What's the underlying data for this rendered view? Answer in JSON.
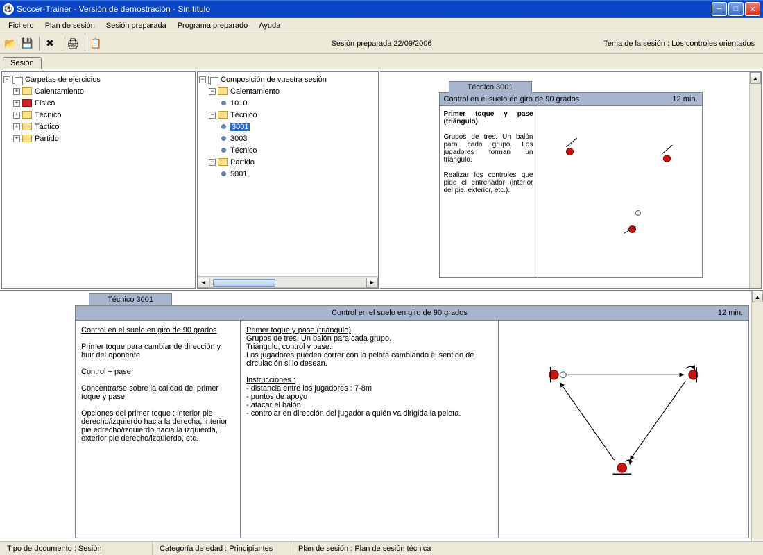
{
  "titlebar": "Soccer-Trainer - Versión de demostración - Sin título",
  "menu": {
    "fichero": "Fichero",
    "plan": "Plan de sesión",
    "sesion": "Sesión preparada",
    "programa": "Programa preparado",
    "ayuda": "Ayuda"
  },
  "info_center": "Sesión preparada 22/09/2006",
  "info_right": "Tema de la sesión : Los controles orientados",
  "tab": "Sesión",
  "tree_left": {
    "root": "Carpetas de ejercicios",
    "items": [
      "Calentamiento",
      "Físico",
      "Técnico",
      "Táctico",
      "Partido"
    ]
  },
  "tree_mid": {
    "root": "Composición de vuestra sesión",
    "cal_label": "Calentamiento",
    "cal_item": "1010",
    "tec_label": "Técnico",
    "tec_items": [
      "3001",
      "3003",
      "Técnico"
    ],
    "par_label": "Partido",
    "par_item": "5001"
  },
  "card_small": {
    "tab": "Técnico 3001",
    "title": "Control en el suelo en giro de 90 grados",
    "time": "12 min.",
    "heading": "Primer toque y pase (triángulo)",
    "p1": "Grupos de tres. Un balón para cada grupo. Los jugadores forman un triángulo.",
    "p2": "Realizar los controles que pide el entrenador (interior del pie, exterior, etc.)."
  },
  "card_big": {
    "tab": "Técnico 3001",
    "title": "Control en el suelo en giro de 90 grados",
    "time": "12 min.",
    "col1_title": "Control en el suelo en giro de 90 grados",
    "col1_l1": "Primer toque para cambiar de dirección y huir del oponente",
    "col1_l2": "Control + pase",
    "col1_l3": "Concentrarse sobre la calidad del primer toque y pase",
    "col1_l4": "Opciones del primer toque : interior pie derecho/izquierdo hacia la derecha, interior pie edrecho/izquierdo hacia la izquierda, exterior pie derecho/izquierdo, etc.",
    "col2_title": "Primer toque y pase (triángulo)",
    "col2_l1": "Grupos de tres. Un balón para cada grupo.",
    "col2_l2": "Triángulo, control y pase.",
    "col2_l3": "Los jugadores pueden correr con la pelota cambiando el sentido de circulación si lo desean.",
    "col2_inst": "Instrucciones :",
    "col2_i1": "- distancia entre los jugadores : 7-8m",
    "col2_i2": "- puntos de apoyo",
    "col2_i3": "- atacar el balón",
    "col2_i4": "- controlar en dirección del jugador a quién va dirigida la pelota."
  },
  "status": {
    "s1": "Tipo de documento : Sesión",
    "s2": "Categoría de edad : Principiantes",
    "s3": "Plan de sesión : Plan de sesión técnica"
  }
}
